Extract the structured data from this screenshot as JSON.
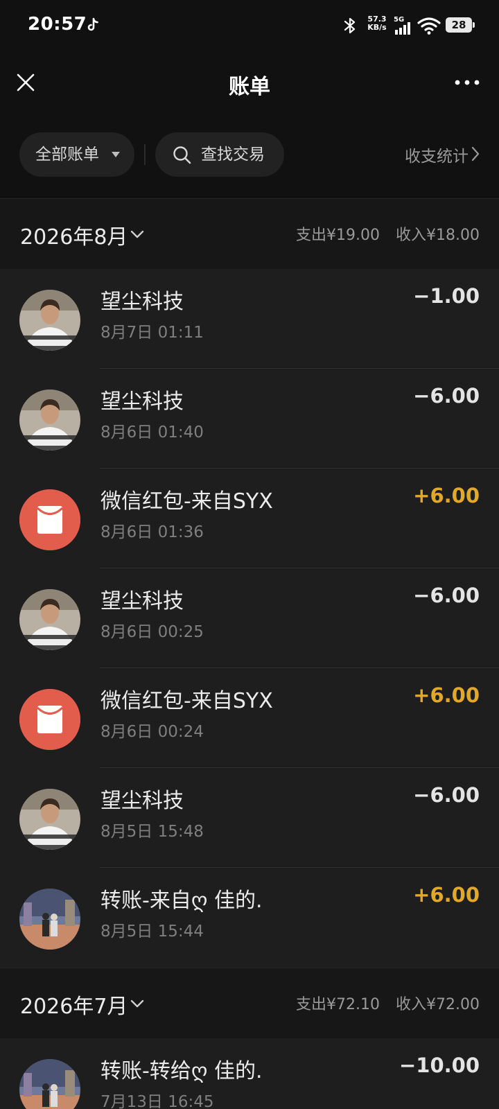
{
  "status_bar": {
    "time": "20:57",
    "net_speed_value": "57.3",
    "net_speed_unit": "KB/s",
    "network": "5G",
    "battery": "28"
  },
  "header": {
    "title": "账单"
  },
  "filters": {
    "all_bills": "全部账单",
    "search": "查找交易",
    "stats": "收支统计"
  },
  "months": [
    {
      "label": "2026年8月",
      "expense": "支出¥19.00",
      "income": "收入¥18.00",
      "transactions": [
        {
          "name": "望尘科技",
          "time": "8月7日 01:11",
          "amount": "−1.00",
          "type": "expense",
          "avatar": "person"
        },
        {
          "name": "望尘科技",
          "time": "8月6日 01:40",
          "amount": "−6.00",
          "type": "expense",
          "avatar": "person"
        },
        {
          "name": "微信红包-来自SYX",
          "time": "8月6日 01:36",
          "amount": "+6.00",
          "type": "income",
          "avatar": "red-packet"
        },
        {
          "name": "望尘科技",
          "time": "8月6日 00:25",
          "amount": "−6.00",
          "type": "expense",
          "avatar": "person"
        },
        {
          "name": "微信红包-来自SYX",
          "time": "8月6日 00:24",
          "amount": "+6.00",
          "type": "income",
          "avatar": "red-packet"
        },
        {
          "name": "望尘科技",
          "time": "8月5日 15:48",
          "amount": "−6.00",
          "type": "expense",
          "avatar": "person"
        },
        {
          "name": "转账-来自ღ 佳的.",
          "time": "8月5日 15:44",
          "amount": "+6.00",
          "type": "income",
          "avatar": "couple"
        }
      ]
    },
    {
      "label": "2026年7月",
      "expense": "支出¥72.10",
      "income": "收入¥72.00",
      "transactions": [
        {
          "name": "转账-转给ღ 佳的.",
          "time": "7月13日 16:45",
          "amount": "−10.00",
          "type": "expense",
          "avatar": "couple"
        }
      ]
    }
  ],
  "colors": {
    "background": "#111111",
    "list_background": "#1e1e1e",
    "income": "#e2a82a",
    "red_packet": "#e35d4d"
  }
}
